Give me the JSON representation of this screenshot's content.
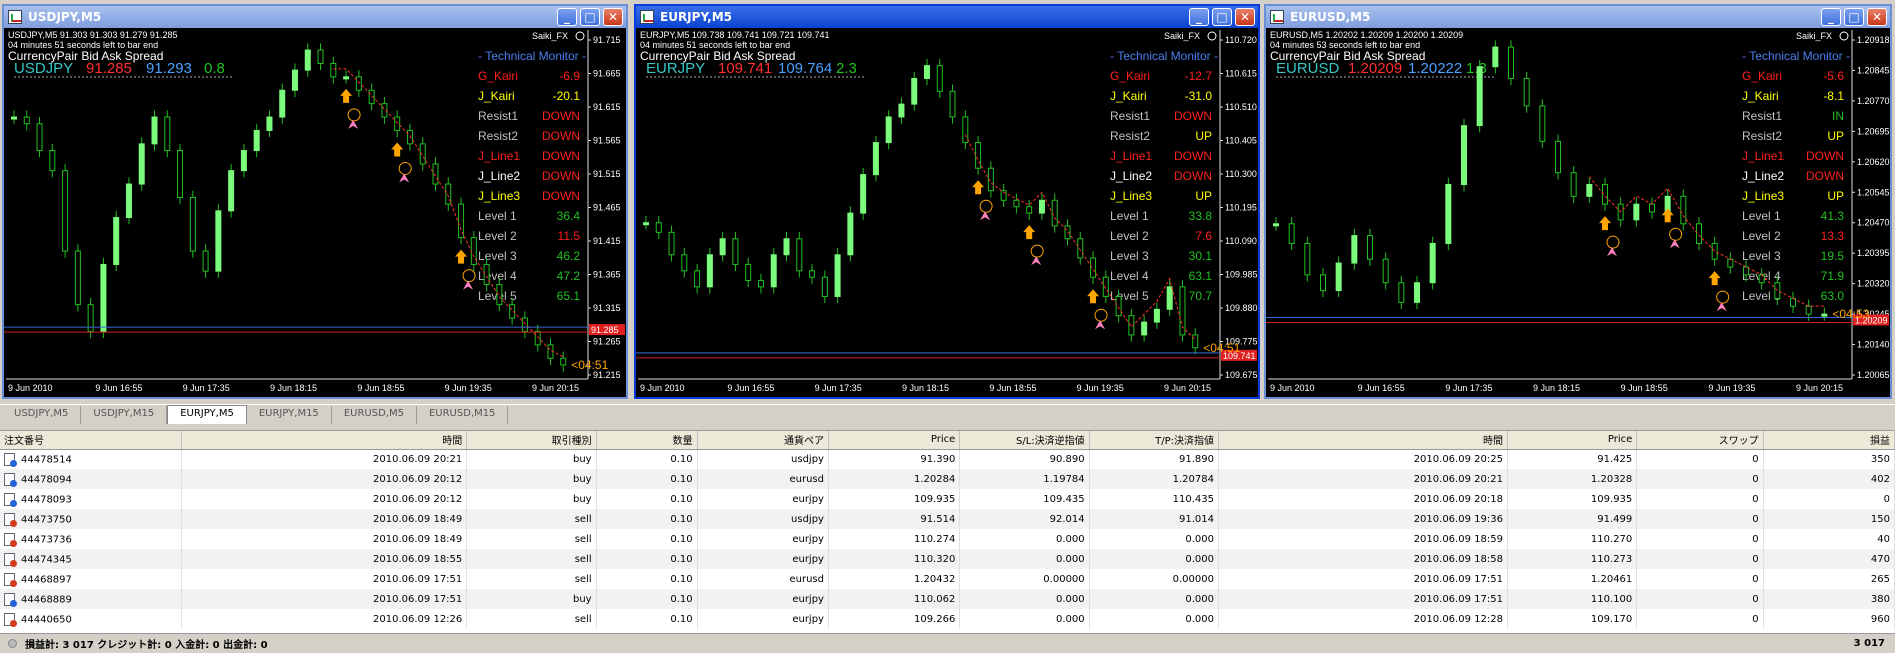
{
  "windows": [
    {
      "title": "USDJPY,M5",
      "active": false,
      "header_line1": "USDJPY,M5  91.303 91.303 91.279 91.285",
      "header_line2": "04 minutes 51 seconds left to bar end",
      "saiki": "Saiki_FX",
      "pair_header": "CurrencyPair  Bid         Ask      Spread",
      "pair": "USDJPY",
      "bid": "91.285",
      "ask": "91.293",
      "spread": "0.8",
      "monitor_title": "- Technical  Monitor -",
      "indicators": [
        {
          "label": "G_Kairi",
          "value": "-6.9",
          "lcolor": "#ff2020",
          "vcolor": "#ff2020"
        },
        {
          "label": "J_Kairi",
          "value": "-20.1",
          "lcolor": "#ffff00",
          "vcolor": "#ffff00"
        },
        {
          "label": "Resist1",
          "value": "DOWN",
          "lcolor": "#c0c0c0",
          "vcolor": "#ff2020"
        },
        {
          "label": "Resist2",
          "value": "DOWN",
          "lcolor": "#c0c0c0",
          "vcolor": "#ff2020"
        },
        {
          "label": "J_Line1",
          "value": "DOWN",
          "lcolor": "#ff2020",
          "vcolor": "#ff2020"
        },
        {
          "label": "J_Line2",
          "value": "DOWN",
          "lcolor": "#ffffff",
          "vcolor": "#ff2020"
        },
        {
          "label": "J_Line3",
          "value": "DOWN",
          "lcolor": "#ffff00",
          "vcolor": "#ff2020"
        },
        {
          "label": "Level 1",
          "value": "36.4",
          "lcolor": "#c0c0c0",
          "vcolor": "#20c020"
        },
        {
          "label": "Level 2",
          "value": "11.5",
          "lcolor": "#c0c0c0",
          "vcolor": "#ff2020"
        },
        {
          "label": "Level 3",
          "value": "46.2",
          "lcolor": "#c0c0c0",
          "vcolor": "#20c020"
        },
        {
          "label": "Level 4",
          "value": "47.2",
          "lcolor": "#c0c0c0",
          "vcolor": "#20c020"
        },
        {
          "label": "Level 5",
          "value": "65.1",
          "lcolor": "#c0c0c0",
          "vcolor": "#20c020"
        }
      ],
      "price_axis": [
        "91.715",
        "91.665",
        "91.615",
        "91.565",
        "91.515",
        "91.465",
        "91.415",
        "91.365",
        "91.315",
        "91.265",
        "91.215"
      ],
      "price_marker": "91.285",
      "time_axis": [
        "9 Jun 2010",
        "9 Jun 16:55",
        "9 Jun 17:35",
        "9 Jun 18:15",
        "9 Jun 18:55",
        "9 Jun 19:35",
        "9 Jun 20:15"
      ],
      "countdown": "<04:51",
      "closes": [
        91.6,
        91.59,
        91.55,
        91.52,
        91.4,
        91.32,
        91.28,
        91.38,
        91.45,
        91.5,
        91.56,
        91.6,
        91.55,
        91.48,
        91.4,
        91.37,
        91.46,
        91.52,
        91.55,
        91.58,
        91.6,
        91.64,
        91.67,
        91.7,
        91.68,
        91.66,
        91.66,
        91.64,
        91.62,
        91.6,
        91.58,
        91.56,
        91.53,
        91.5,
        91.47,
        91.42,
        91.38,
        91.35,
        91.32,
        91.3,
        91.28,
        91.26,
        91.24,
        91.23
      ]
    },
    {
      "title": "EURJPY,M5",
      "active": true,
      "header_line1": "EURJPY,M5  109.738 109.741 109.721 109.741",
      "header_line2": "04 minutes 51 seconds left to bar end",
      "saiki": "Saiki_FX",
      "pair_header": "CurrencyPair  Bid         Ask       Spread",
      "pair": "EURJPY",
      "bid": "109.741",
      "ask": "109.764",
      "spread": "2.3",
      "monitor_title": "- Technical  Monitor -",
      "indicators": [
        {
          "label": "G_Kairi",
          "value": "-12.7",
          "lcolor": "#ff2020",
          "vcolor": "#ff2020"
        },
        {
          "label": "J_Kairi",
          "value": "-31.0",
          "lcolor": "#ffff00",
          "vcolor": "#ffff00"
        },
        {
          "label": "Resist1",
          "value": "DOWN",
          "lcolor": "#c0c0c0",
          "vcolor": "#ff2020"
        },
        {
          "label": "Resist2",
          "value": "UP",
          "lcolor": "#c0c0c0",
          "vcolor": "#ffff00"
        },
        {
          "label": "J_Line1",
          "value": "DOWN",
          "lcolor": "#ff2020",
          "vcolor": "#ff2020"
        },
        {
          "label": "J_Line2",
          "value": "DOWN",
          "lcolor": "#ffffff",
          "vcolor": "#ff2020"
        },
        {
          "label": "J_Line3",
          "value": "UP",
          "lcolor": "#ffff00",
          "vcolor": "#ffff00"
        },
        {
          "label": "Level 1",
          "value": "33.8",
          "lcolor": "#c0c0c0",
          "vcolor": "#20c020"
        },
        {
          "label": "Level 2",
          "value": "7.6",
          "lcolor": "#c0c0c0",
          "vcolor": "#ff2020"
        },
        {
          "label": "Level 3",
          "value": "30.1",
          "lcolor": "#c0c0c0",
          "vcolor": "#20c020"
        },
        {
          "label": "Level 4",
          "value": "63.1",
          "lcolor": "#c0c0c0",
          "vcolor": "#20c020"
        },
        {
          "label": "Level 5",
          "value": "70.7",
          "lcolor": "#c0c0c0",
          "vcolor": "#20c020"
        }
      ],
      "price_axis": [
        "110.720",
        "110.615",
        "110.510",
        "110.405",
        "110.300",
        "110.195",
        "110.090",
        "109.985",
        "109.880",
        "109.775",
        "109.675"
      ],
      "price_marker": "109.741",
      "time_axis": [
        "9 Jun 2010",
        "9 Jun 16:55",
        "9 Jun 17:35",
        "9 Jun 18:15",
        "9 Jun 18:55",
        "9 Jun 19:35",
        "9 Jun 20:15"
      ],
      "countdown": "<04:51",
      "closes": [
        110.15,
        110.12,
        110.05,
        110.0,
        109.95,
        110.05,
        110.1,
        110.02,
        109.97,
        109.95,
        110.05,
        110.1,
        110.0,
        109.98,
        109.92,
        110.05,
        110.18,
        110.3,
        110.4,
        110.48,
        110.52,
        110.6,
        110.64,
        110.56,
        110.48,
        110.4,
        110.32,
        110.25,
        110.22,
        110.2,
        110.18,
        110.22,
        110.14,
        110.1,
        110.04,
        109.98,
        109.92,
        109.86,
        109.8,
        109.84,
        109.88,
        109.95,
        109.8,
        109.76
      ]
    },
    {
      "title": "EURUSD,M5",
      "active": false,
      "header_line1": "EURUSD,M5  1.20202 1.20209 1.20200 1.20209",
      "header_line2": "04 minutes 53 seconds left to bar end",
      "saiki": "Saiki_FX",
      "pair_header": "CurrencyPair  Bid         Ask      Spread",
      "pair": "EURUSD",
      "bid": "1.20209",
      "ask": "1.20222",
      "spread": "1.3",
      "monitor_title": "- Technical  Monitor -",
      "indicators": [
        {
          "label": "G_Kairi",
          "value": "-5.6",
          "lcolor": "#ff2020",
          "vcolor": "#ff2020"
        },
        {
          "label": "J_Kairi",
          "value": "-8.1",
          "lcolor": "#ffff00",
          "vcolor": "#ffff00"
        },
        {
          "label": "Resist1",
          "value": "IN",
          "lcolor": "#c0c0c0",
          "vcolor": "#20c020"
        },
        {
          "label": "Resist2",
          "value": "UP",
          "lcolor": "#c0c0c0",
          "vcolor": "#ffff00"
        },
        {
          "label": "J_Line1",
          "value": "DOWN",
          "lcolor": "#ff2020",
          "vcolor": "#ff2020"
        },
        {
          "label": "J_Line2",
          "value": "DOWN",
          "lcolor": "#ffffff",
          "vcolor": "#ff2020"
        },
        {
          "label": "J_Line3",
          "value": "UP",
          "lcolor": "#ffff00",
          "vcolor": "#ffff00"
        },
        {
          "label": "Level 1",
          "value": "41.3",
          "lcolor": "#c0c0c0",
          "vcolor": "#20c020"
        },
        {
          "label": "Level 2",
          "value": "13.3",
          "lcolor": "#c0c0c0",
          "vcolor": "#ff2020"
        },
        {
          "label": "Level 3",
          "value": "19.5",
          "lcolor": "#c0c0c0",
          "vcolor": "#20c020"
        },
        {
          "label": "Level 4",
          "value": "71.9",
          "lcolor": "#c0c0c0",
          "vcolor": "#20c020"
        },
        {
          "label": "Level 5",
          "value": "63.0",
          "lcolor": "#c0c0c0",
          "vcolor": "#20c020"
        }
      ],
      "price_axis": [
        "1.20918",
        "1.20845",
        "1.20770",
        "1.20695",
        "1.20620",
        "1.20545",
        "1.20470",
        "1.20395",
        "1.20320",
        "1.20245",
        "1.20140",
        "1.20065"
      ],
      "price_marker": "1.20209",
      "time_axis": [
        "9 Jun 2010",
        "9 Jun 16:55",
        "9 Jun 17:35",
        "9 Jun 18:15",
        "9 Jun 18:55",
        "9 Jun 19:35",
        "9 Jun 20:15"
      ],
      "countdown": "<04:53",
      "closes": [
        1.2045,
        1.204,
        1.2032,
        1.2028,
        1.2035,
        1.2042,
        1.2036,
        1.203,
        1.2025,
        1.203,
        1.204,
        1.2055,
        1.207,
        1.2085,
        1.209,
        1.2082,
        1.2075,
        1.2066,
        1.2058,
        1.2052,
        1.2055,
        1.205,
        1.2046,
        1.205,
        1.2048,
        1.2052,
        1.2045,
        1.204,
        1.2036,
        1.2034,
        1.2032,
        1.203,
        1.2026,
        1.2024,
        1.2022,
        1.2022
      ]
    }
  ],
  "tabs": [
    "USDJPY,M5",
    "USDJPY,M15",
    "EURJPY,M5",
    "EURJPY,M15",
    "EURUSD,M5",
    "EURUSD,M15"
  ],
  "active_tab": 2,
  "table": {
    "headers": [
      "注文番号",
      "時間",
      "取引種別",
      "数量",
      "通貨ペア",
      "Price",
      "S/L:決済逆指値",
      "T/P:決済指値",
      "時間",
      "Price",
      "スワップ",
      "損益"
    ],
    "rows": [
      [
        "44478514",
        "2010.06.09 20:21",
        "buy",
        "0.10",
        "usdjpy",
        "91.390",
        "90.890",
        "91.890",
        "2010.06.09 20:25",
        "91.425",
        "0",
        "350"
      ],
      [
        "44478094",
        "2010.06.09 20:12",
        "buy",
        "0.10",
        "eurusd",
        "1.20284",
        "1.19784",
        "1.20784",
        "2010.06.09 20:21",
        "1.20328",
        "0",
        "402"
      ],
      [
        "44478093",
        "2010.06.09 20:12",
        "buy",
        "0.10",
        "eurjpy",
        "109.935",
        "109.435",
        "110.435",
        "2010.06.09 20:18",
        "109.935",
        "0",
        "0"
      ],
      [
        "44473750",
        "2010.06.09 18:49",
        "sell",
        "0.10",
        "usdjpy",
        "91.514",
        "92.014",
        "91.014",
        "2010.06.09 19:36",
        "91.499",
        "0",
        "150"
      ],
      [
        "44473736",
        "2010.06.09 18:49",
        "sell",
        "0.10",
        "eurjpy",
        "110.274",
        "0.000",
        "0.000",
        "2010.06.09 18:59",
        "110.270",
        "0",
        "40"
      ],
      [
        "44474345",
        "2010.06.09 18:55",
        "sell",
        "0.10",
        "eurjpy",
        "110.320",
        "0.000",
        "0.000",
        "2010.06.09 18:58",
        "110.273",
        "0",
        "470"
      ],
      [
        "44468897",
        "2010.06.09 17:51",
        "sell",
        "0.10",
        "eurusd",
        "1.20432",
        "0.00000",
        "0.00000",
        "2010.06.09 17:51",
        "1.20461",
        "0",
        "265"
      ],
      [
        "44468889",
        "2010.06.09 17:51",
        "buy",
        "0.10",
        "eurjpy",
        "110.062",
        "0.000",
        "0.000",
        "2010.06.09 17:51",
        "110.100",
        "0",
        "380"
      ],
      [
        "44440650",
        "2010.06.09 12:26",
        "sell",
        "0.10",
        "eurjpy",
        "109.266",
        "0.000",
        "0.000",
        "2010.06.09 12:28",
        "109.170",
        "0",
        "960"
      ]
    ]
  },
  "footer": {
    "summary": "損益計: 3 017  クレジット計: 0  入金計: 0  出金計: 0",
    "total": "3 017"
  },
  "colors": {
    "bull": "#7cfc7c",
    "bear": "#20c020",
    "pair_label": "#36c7c7",
    "bid": "#ff3030",
    "ask": "#4aa0ff",
    "spread": "#20c020",
    "bid_line": "#d02020",
    "ask_line": "#3a6ad8",
    "arrow": "#ffa500",
    "sad": "#ffa500",
    "pink": "#ff80c0"
  }
}
